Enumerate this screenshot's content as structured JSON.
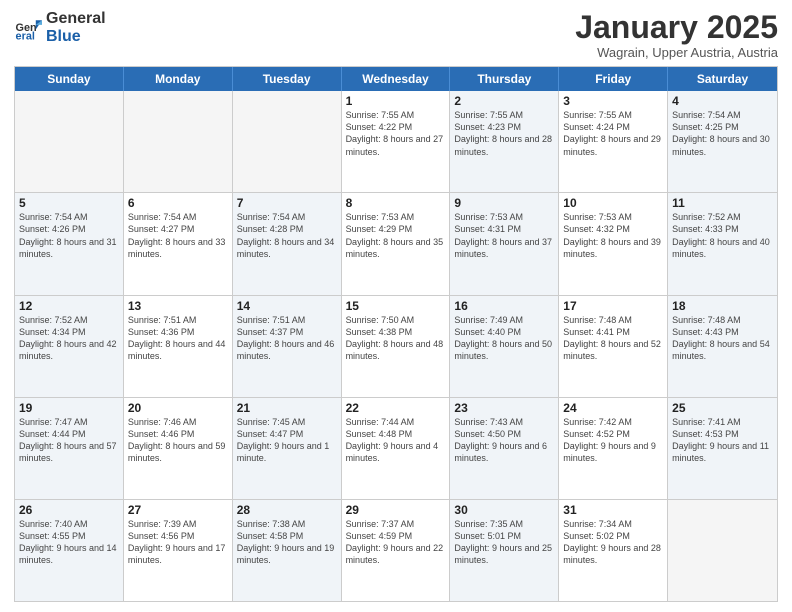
{
  "header": {
    "logo_general": "General",
    "logo_blue": "Blue",
    "title": "January 2025",
    "subtitle": "Wagrain, Upper Austria, Austria"
  },
  "days_of_week": [
    "Sunday",
    "Monday",
    "Tuesday",
    "Wednesday",
    "Thursday",
    "Friday",
    "Saturday"
  ],
  "weeks": [
    [
      {
        "num": "",
        "info": "",
        "empty": true
      },
      {
        "num": "",
        "info": "",
        "empty": true
      },
      {
        "num": "",
        "info": "",
        "empty": true
      },
      {
        "num": "1",
        "info": "Sunrise: 7:55 AM\nSunset: 4:22 PM\nDaylight: 8 hours and 27 minutes.",
        "empty": false
      },
      {
        "num": "2",
        "info": "Sunrise: 7:55 AM\nSunset: 4:23 PM\nDaylight: 8 hours and 28 minutes.",
        "empty": false
      },
      {
        "num": "3",
        "info": "Sunrise: 7:55 AM\nSunset: 4:24 PM\nDaylight: 8 hours and 29 minutes.",
        "empty": false
      },
      {
        "num": "4",
        "info": "Sunrise: 7:54 AM\nSunset: 4:25 PM\nDaylight: 8 hours and 30 minutes.",
        "empty": false
      }
    ],
    [
      {
        "num": "5",
        "info": "Sunrise: 7:54 AM\nSunset: 4:26 PM\nDaylight: 8 hours and 31 minutes.",
        "empty": false
      },
      {
        "num": "6",
        "info": "Sunrise: 7:54 AM\nSunset: 4:27 PM\nDaylight: 8 hours and 33 minutes.",
        "empty": false
      },
      {
        "num": "7",
        "info": "Sunrise: 7:54 AM\nSunset: 4:28 PM\nDaylight: 8 hours and 34 minutes.",
        "empty": false
      },
      {
        "num": "8",
        "info": "Sunrise: 7:53 AM\nSunset: 4:29 PM\nDaylight: 8 hours and 35 minutes.",
        "empty": false
      },
      {
        "num": "9",
        "info": "Sunrise: 7:53 AM\nSunset: 4:31 PM\nDaylight: 8 hours and 37 minutes.",
        "empty": false
      },
      {
        "num": "10",
        "info": "Sunrise: 7:53 AM\nSunset: 4:32 PM\nDaylight: 8 hours and 39 minutes.",
        "empty": false
      },
      {
        "num": "11",
        "info": "Sunrise: 7:52 AM\nSunset: 4:33 PM\nDaylight: 8 hours and 40 minutes.",
        "empty": false
      }
    ],
    [
      {
        "num": "12",
        "info": "Sunrise: 7:52 AM\nSunset: 4:34 PM\nDaylight: 8 hours and 42 minutes.",
        "empty": false
      },
      {
        "num": "13",
        "info": "Sunrise: 7:51 AM\nSunset: 4:36 PM\nDaylight: 8 hours and 44 minutes.",
        "empty": false
      },
      {
        "num": "14",
        "info": "Sunrise: 7:51 AM\nSunset: 4:37 PM\nDaylight: 8 hours and 46 minutes.",
        "empty": false
      },
      {
        "num": "15",
        "info": "Sunrise: 7:50 AM\nSunset: 4:38 PM\nDaylight: 8 hours and 48 minutes.",
        "empty": false
      },
      {
        "num": "16",
        "info": "Sunrise: 7:49 AM\nSunset: 4:40 PM\nDaylight: 8 hours and 50 minutes.",
        "empty": false
      },
      {
        "num": "17",
        "info": "Sunrise: 7:48 AM\nSunset: 4:41 PM\nDaylight: 8 hours and 52 minutes.",
        "empty": false
      },
      {
        "num": "18",
        "info": "Sunrise: 7:48 AM\nSunset: 4:43 PM\nDaylight: 8 hours and 54 minutes.",
        "empty": false
      }
    ],
    [
      {
        "num": "19",
        "info": "Sunrise: 7:47 AM\nSunset: 4:44 PM\nDaylight: 8 hours and 57 minutes.",
        "empty": false
      },
      {
        "num": "20",
        "info": "Sunrise: 7:46 AM\nSunset: 4:46 PM\nDaylight: 8 hours and 59 minutes.",
        "empty": false
      },
      {
        "num": "21",
        "info": "Sunrise: 7:45 AM\nSunset: 4:47 PM\nDaylight: 9 hours and 1 minute.",
        "empty": false
      },
      {
        "num": "22",
        "info": "Sunrise: 7:44 AM\nSunset: 4:48 PM\nDaylight: 9 hours and 4 minutes.",
        "empty": false
      },
      {
        "num": "23",
        "info": "Sunrise: 7:43 AM\nSunset: 4:50 PM\nDaylight: 9 hours and 6 minutes.",
        "empty": false
      },
      {
        "num": "24",
        "info": "Sunrise: 7:42 AM\nSunset: 4:52 PM\nDaylight: 9 hours and 9 minutes.",
        "empty": false
      },
      {
        "num": "25",
        "info": "Sunrise: 7:41 AM\nSunset: 4:53 PM\nDaylight: 9 hours and 11 minutes.",
        "empty": false
      }
    ],
    [
      {
        "num": "26",
        "info": "Sunrise: 7:40 AM\nSunset: 4:55 PM\nDaylight: 9 hours and 14 minutes.",
        "empty": false
      },
      {
        "num": "27",
        "info": "Sunrise: 7:39 AM\nSunset: 4:56 PM\nDaylight: 9 hours and 17 minutes.",
        "empty": false
      },
      {
        "num": "28",
        "info": "Sunrise: 7:38 AM\nSunset: 4:58 PM\nDaylight: 9 hours and 19 minutes.",
        "empty": false
      },
      {
        "num": "29",
        "info": "Sunrise: 7:37 AM\nSunset: 4:59 PM\nDaylight: 9 hours and 22 minutes.",
        "empty": false
      },
      {
        "num": "30",
        "info": "Sunrise: 7:35 AM\nSunset: 5:01 PM\nDaylight: 9 hours and 25 minutes.",
        "empty": false
      },
      {
        "num": "31",
        "info": "Sunrise: 7:34 AM\nSunset: 5:02 PM\nDaylight: 9 hours and 28 minutes.",
        "empty": false
      },
      {
        "num": "",
        "info": "",
        "empty": true
      }
    ]
  ]
}
